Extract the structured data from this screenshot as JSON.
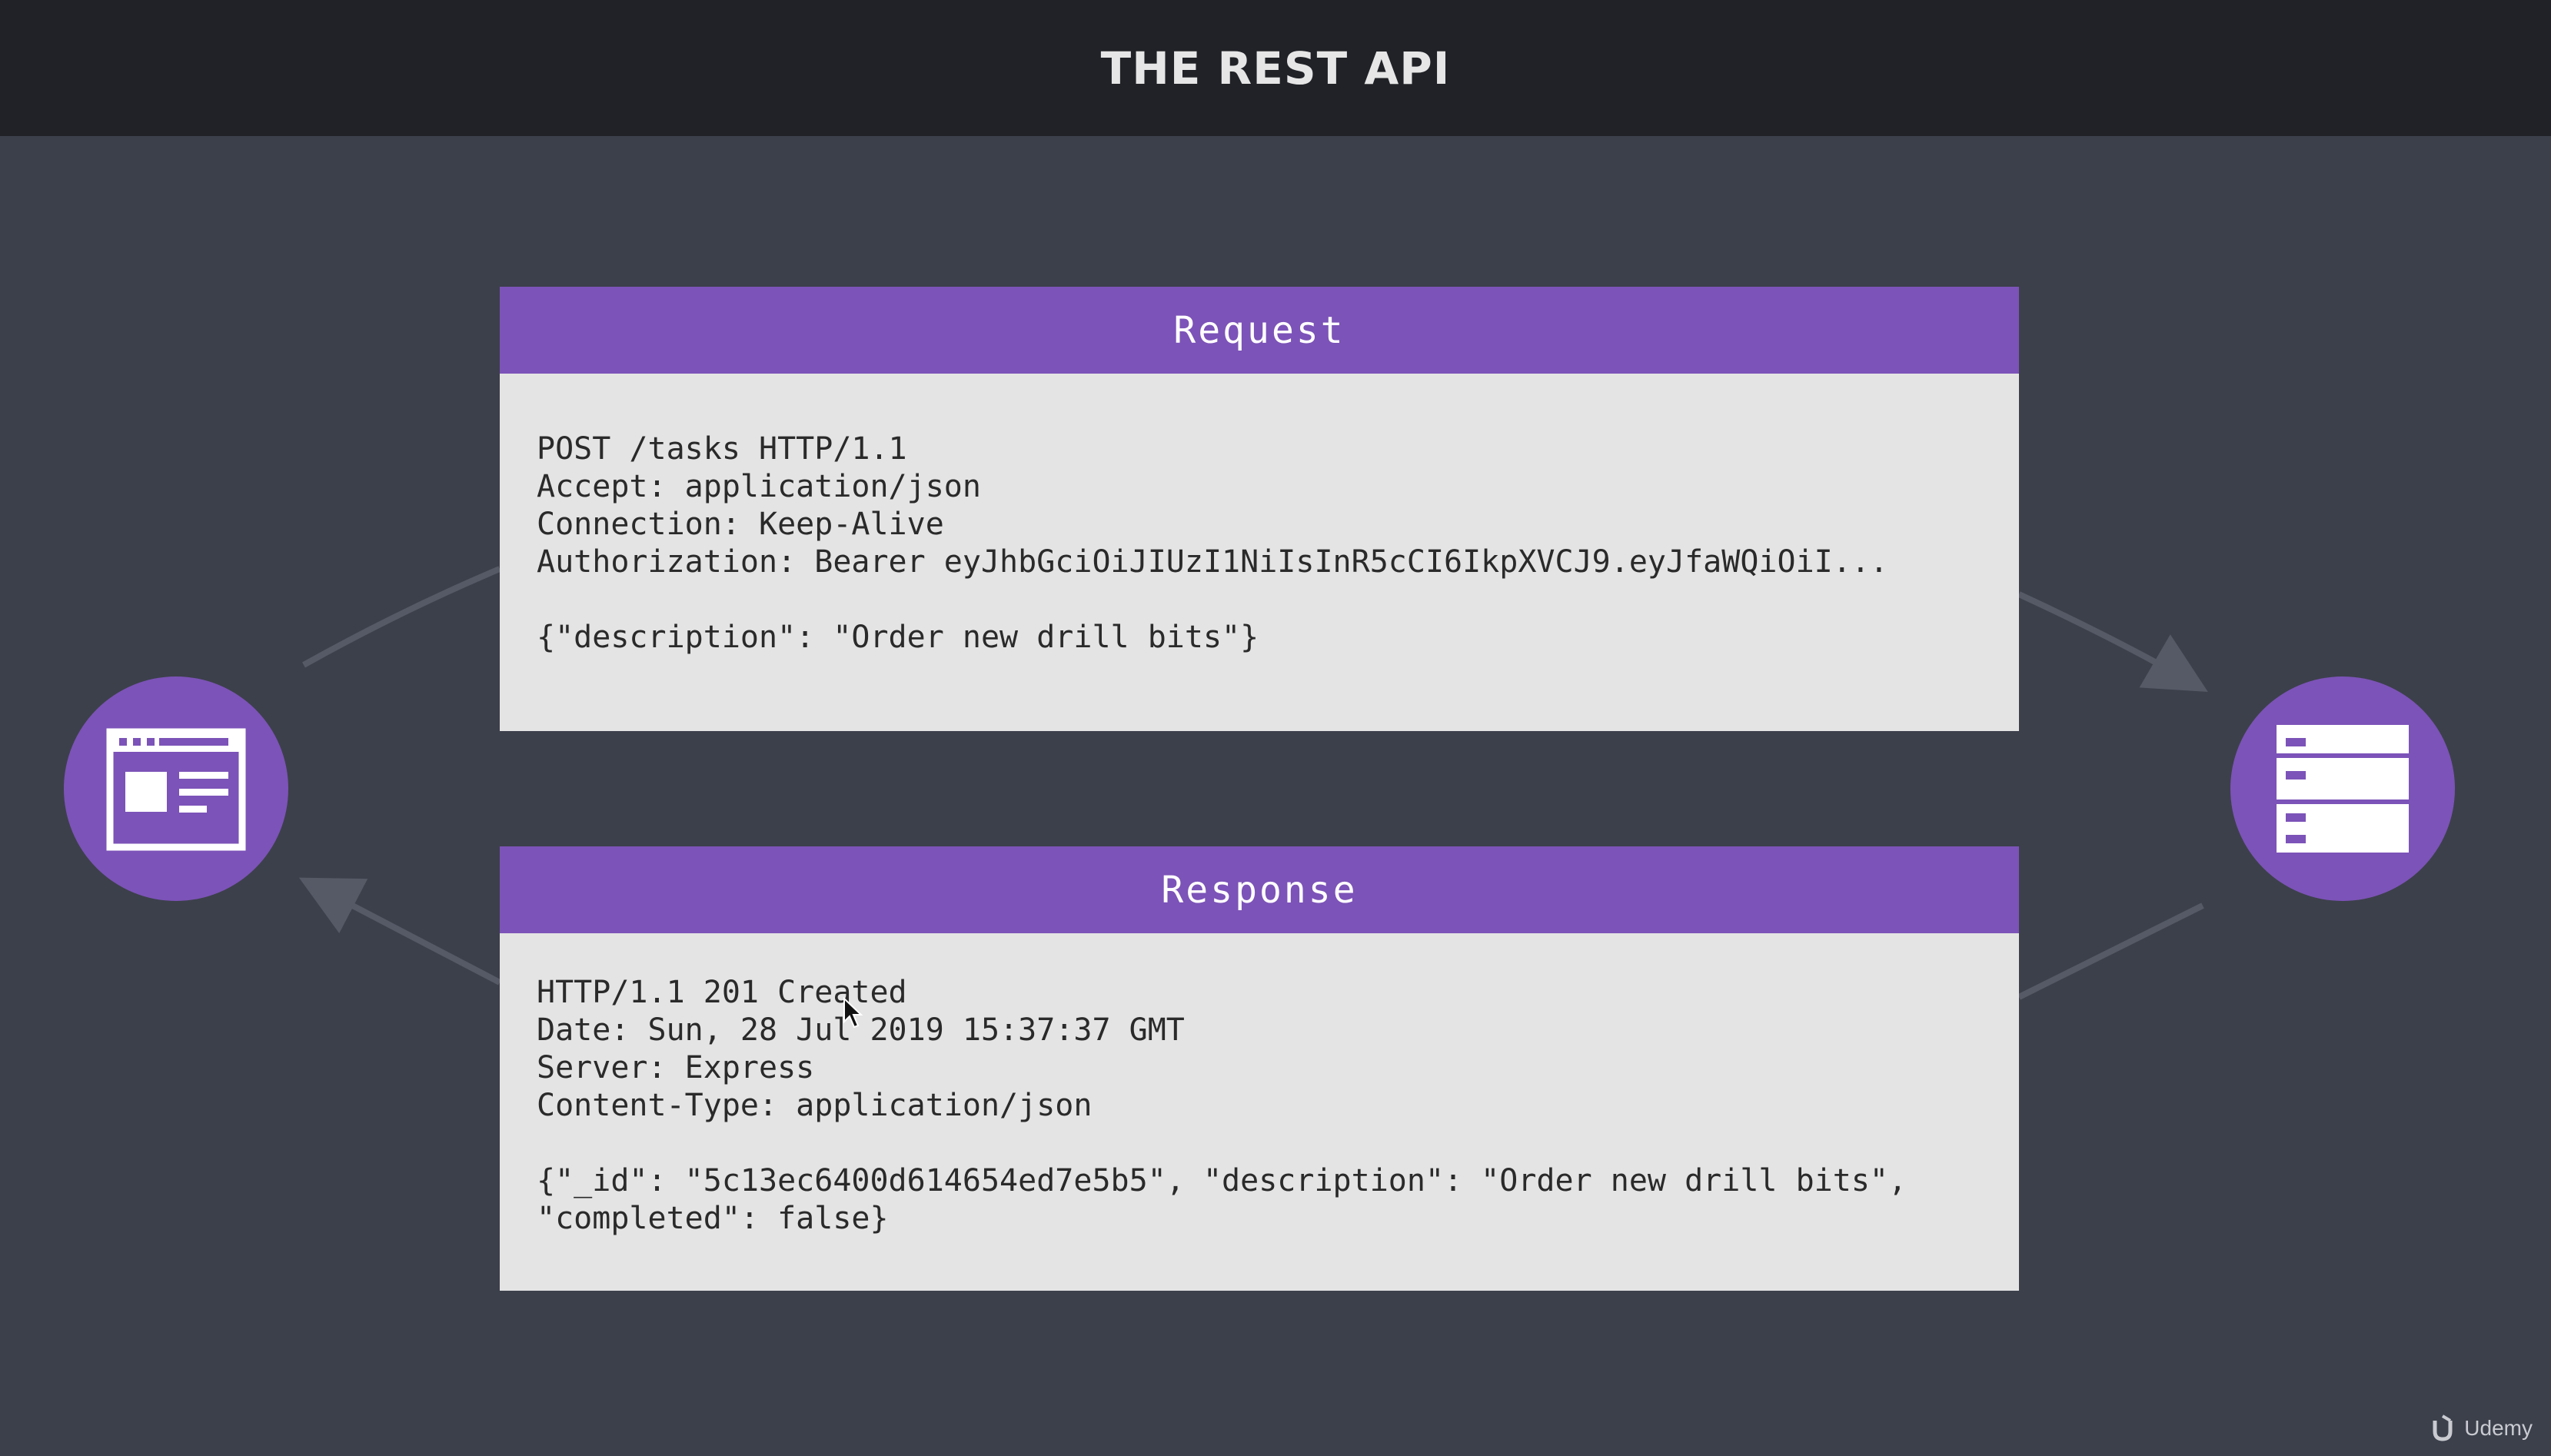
{
  "header": {
    "title": "THE REST API"
  },
  "request": {
    "title": "Request",
    "lines": [
      "POST /tasks HTTP/1.1",
      "Accept: application/json",
      "Connection: Keep-Alive",
      "Authorization: Bearer eyJhbGciOiJIUzI1NiIsInR5cCI6IkpXVCJ9.eyJfaWQiOiI...",
      "",
      "{\"description\": \"Order new drill bits\"}"
    ]
  },
  "response": {
    "title": "Response",
    "lines": [
      "HTTP/1.1 201 Created",
      "Date: Sun, 28 Jul 2019 15:37:37 GMT",
      "Server: Express",
      "Content-Type: application/json",
      "",
      "{\"_id\": \"5c13ec6400d614654ed7e5b5\", \"description\": \"Order new drill bits\",",
      "\"completed\": false}"
    ]
  },
  "nodes": {
    "client_icon": "browser-window-icon",
    "server_icon": "server-icon"
  },
  "watermark": {
    "text": "Udemy"
  },
  "colors": {
    "accent": "#7c53b8",
    "background": "#3c404b",
    "header_bar": "#202227",
    "panel_body": "#e4e4e4"
  }
}
